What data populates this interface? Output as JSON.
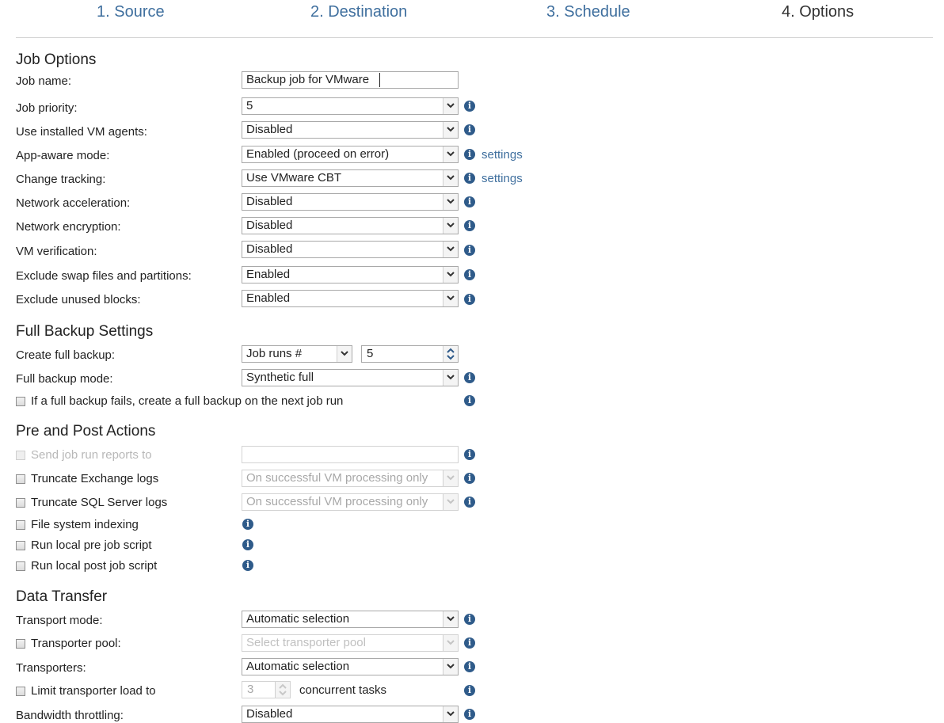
{
  "wizard": {
    "tabs": [
      {
        "label": "1. Source"
      },
      {
        "label": "2. Destination"
      },
      {
        "label": "3. Schedule"
      },
      {
        "label": "4. Options"
      }
    ]
  },
  "job_options": {
    "title": "Job Options",
    "job_name_label": "Job name:",
    "job_name_value": "Backup job for VMware",
    "rows": [
      {
        "label": "Job priority:",
        "value": "5"
      },
      {
        "label": "Use installed VM agents:",
        "value": "Disabled"
      },
      {
        "label": "App-aware mode:",
        "value": "Enabled (proceed on error)",
        "link": "settings"
      },
      {
        "label": "Change tracking:",
        "value": "Use VMware CBT",
        "link": "settings"
      },
      {
        "label": "Network acceleration:",
        "value": "Disabled"
      },
      {
        "label": "Network encryption:",
        "value": "Disabled"
      },
      {
        "label": "VM verification:",
        "value": "Disabled"
      },
      {
        "label": "Exclude swap files and partitions:",
        "value": "Enabled"
      },
      {
        "label": "Exclude unused blocks:",
        "value": "Enabled"
      }
    ]
  },
  "full_backup": {
    "title": "Full Backup Settings",
    "create_label": "Create full backup:",
    "create_mode": "Job runs #",
    "create_count": "5",
    "mode_label": "Full backup mode:",
    "mode_value": "Synthetic full",
    "fail_checkbox_label": "If a full backup fails, create a full backup on the next job run"
  },
  "pre_post": {
    "title": "Pre and Post Actions",
    "send_reports_label": "Send job run reports to",
    "send_reports_value": "",
    "exchange_label": "Truncate Exchange logs",
    "exchange_value": "On successful VM processing only",
    "sql_label": "Truncate SQL Server logs",
    "sql_value": "On successful VM processing only",
    "indexing_label": "File system indexing",
    "pre_script_label": "Run local pre job script",
    "post_script_label": "Run local post job script"
  },
  "data_transfer": {
    "title": "Data Transfer",
    "transport_label": "Transport mode:",
    "transport_value": "Automatic selection",
    "pool_label": "Transporter pool:",
    "pool_placeholder": "Select transporter pool",
    "transporters_label": "Transporters:",
    "transporters_value": "Automatic selection",
    "limit_label": "Limit transporter load to",
    "limit_value": "3",
    "limit_suffix": "concurrent tasks",
    "bandwidth_label": "Bandwidth throttling:",
    "bandwidth_value": "Disabled"
  },
  "icons": {
    "info": "info-icon",
    "dropdown": "chevron-down-icon",
    "spinner": "spinner-arrows-icon"
  },
  "colors": {
    "link": "#3f6f9e",
    "info_icon": "#2f5b8a",
    "disabled_text": "#b8b8b8",
    "divider": "#d4d4d4"
  }
}
